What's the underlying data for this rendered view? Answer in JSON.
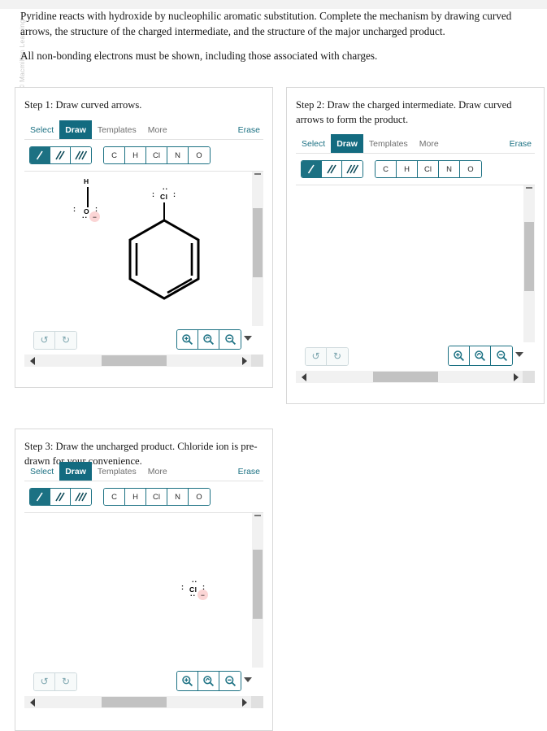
{
  "watermark": "© Macmillan Learning",
  "prompt": {
    "paragraph1": "Pyridine reacts with hydroxide by nucleophilic aromatic substitution. Complete the mechanism by drawing curved arrows, the structure of the charged intermediate, and the structure of the major uncharged product.",
    "paragraph2": "All non-bonding electrons must be shown, including those associated with charges."
  },
  "toolbar": {
    "menu": [
      {
        "label": "Select",
        "active": false
      },
      {
        "label": "Draw",
        "active": true
      },
      {
        "label": "Templates",
        "active": false
      },
      {
        "label": "More",
        "active": false
      }
    ],
    "erase_label": "Erase",
    "bonds": [
      {
        "name": "single-bond",
        "selected": true
      },
      {
        "name": "double-bond",
        "selected": false
      },
      {
        "name": "triple-bond",
        "selected": false
      }
    ],
    "atoms": [
      "C",
      "H",
      "Cl",
      "N",
      "O"
    ],
    "undo_icon": "↺",
    "redo_icon": "↻",
    "zoom_in_icon": "zoom-in",
    "zoom_reset_icon": "zoom-reset",
    "zoom_out_icon": "zoom-out"
  },
  "colors": {
    "teal": "#1c7183",
    "teal_fill": "#136b80",
    "charge_highlight": "#fbd5d5",
    "scroll_thumb": "#c2c2c2",
    "panel_border": "#d8d8d8"
  },
  "panels": [
    {
      "id": "panel1",
      "title": "Step 1: Draw curved arrows.",
      "molecules": {
        "hydroxide": {
          "hydrogen": "H",
          "oxygen": "O",
          "lone_pair_left": ":",
          "lone_pair_right": ":",
          "lone_pair_bottom": "..",
          "charge": "−"
        },
        "chloropyridine": {
          "chlorine": "Cl",
          "lone_pair_top": "..",
          "lone_pair_left": ":",
          "lone_pair_right": ":",
          "ring": "benzene-ring-with-chlorine"
        }
      }
    },
    {
      "id": "panel2",
      "title": "Step 2: Draw the charged intermediate. Draw curved arrows to form the product.",
      "molecules": {}
    },
    {
      "id": "panel3",
      "title": "Step 3: Draw the uncharged product. Chloride ion is pre-drawn for your convenience.",
      "molecules": {
        "chloride": {
          "chlorine": "Cl",
          "lone_pair_top": "..",
          "lone_pair_left": ":",
          "lone_pair_right": ":",
          "lone_pair_bottom": "..",
          "charge": "−"
        }
      }
    }
  ]
}
